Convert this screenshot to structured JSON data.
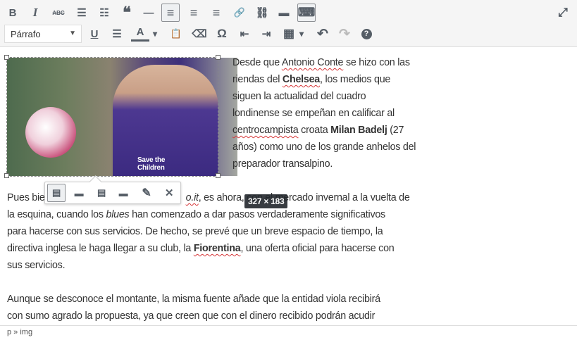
{
  "toolbar": {
    "row1": [
      {
        "name": "bold",
        "glyph": "B"
      },
      {
        "name": "italic",
        "glyph": "I"
      },
      {
        "name": "strikethrough",
        "glyph": "ABC"
      },
      {
        "name": "bullet-list",
        "glyph": "☰"
      },
      {
        "name": "numbered-list",
        "glyph": "☷"
      },
      {
        "name": "blockquote",
        "glyph": "❝"
      },
      {
        "name": "horizontal-line",
        "glyph": "—"
      },
      {
        "name": "align-left",
        "glyph": "≡"
      },
      {
        "name": "align-center",
        "glyph": "≡"
      },
      {
        "name": "align-right",
        "glyph": "≡"
      },
      {
        "name": "link",
        "glyph": "🔗"
      },
      {
        "name": "unlink",
        "glyph": "⛓"
      },
      {
        "name": "read-more",
        "glyph": "▬"
      },
      {
        "name": "toolbar-toggle",
        "glyph": "⌨"
      }
    ],
    "format_select": "Párrafo",
    "row2": [
      {
        "name": "underline",
        "glyph": "U"
      },
      {
        "name": "justify",
        "glyph": "☰"
      },
      {
        "name": "text-color",
        "glyph": "A"
      },
      {
        "name": "text-color-dropdown",
        "glyph": "▾"
      },
      {
        "name": "paste-text",
        "glyph": "📋"
      },
      {
        "name": "clear-formatting",
        "glyph": "⌫"
      },
      {
        "name": "special-character",
        "glyph": "Ω"
      },
      {
        "name": "outdent",
        "glyph": "⇤"
      },
      {
        "name": "indent",
        "glyph": "⇥"
      },
      {
        "name": "table",
        "glyph": "▦"
      },
      {
        "name": "table-dropdown",
        "glyph": "▾"
      },
      {
        "name": "undo",
        "glyph": "↶"
      },
      {
        "name": "redo",
        "glyph": "↷"
      },
      {
        "name": "help",
        "glyph": "?"
      }
    ],
    "fullscreen": "⤢"
  },
  "content": {
    "p1": [
      "Desde que ",
      "Antonio Conte",
      " se hizo con las",
      "riendas del ",
      "Chelsea",
      ", los medios que",
      "siguen la actualidad del cuadro",
      "londinense se empeñan en calificar al",
      "centrocampista",
      " croata ",
      "Milan Badelj",
      " (27",
      "años) como uno de los grande anhelos del",
      "preparador transalpino."
    ],
    "p2": [
      "Pues bie",
      "o.it",
      ", es ahora, con el mercado invernal a la vuelta de",
      "la esquina, cuando los ",
      "blues",
      " han comenzado a dar pasos verdaderamente significativos",
      "para hacerse con sus servicios. De hecho, se prevé que un breve espacio de tiempo, la",
      "directiva inglesa le haga llegar a su club, la ",
      "Fiorentina",
      ", una oferta oficial para hacerse con",
      "sus servicios."
    ],
    "p3": [
      "Aunque se desconoce el montante, la misma fuente añade que la entidad viola recibirá",
      "con sumo agrado la propuesta, ya que creen que con el dinero recibido podrán acudir"
    ]
  },
  "image_toolbar": [
    {
      "name": "align-left",
      "glyph": "▤"
    },
    {
      "name": "align-center",
      "glyph": "▬"
    },
    {
      "name": "align-right",
      "glyph": "▤"
    },
    {
      "name": "no-align",
      "glyph": "▬"
    },
    {
      "name": "edit",
      "glyph": "✎"
    },
    {
      "name": "remove",
      "glyph": "✕"
    }
  ],
  "image_dimensions": "327 × 183",
  "image_text": "Save the Children",
  "statusbar": "p » img"
}
